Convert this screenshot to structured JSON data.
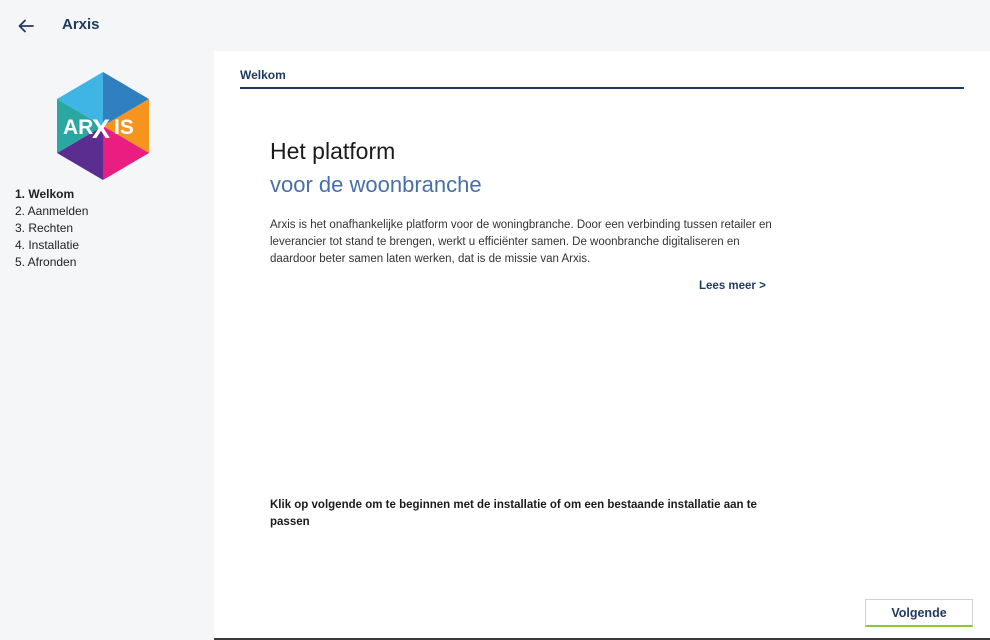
{
  "header": {
    "app_title": "Arxis",
    "back_icon": "arrow-left-icon"
  },
  "logo": {
    "text_left": "AR",
    "text_x": "X",
    "text_right": "IS",
    "colors": [
      "#2f7fc1",
      "#f7941d",
      "#e91e80",
      "#5c2d91",
      "#2aa7a0",
      "#3fb5e6"
    ]
  },
  "steps": [
    {
      "label": "1. Welkom",
      "active": true
    },
    {
      "label": "2. Aanmelden",
      "active": false
    },
    {
      "label": "3. Rechten",
      "active": false
    },
    {
      "label": "4. Installatie",
      "active": false
    },
    {
      "label": "5. Afronden",
      "active": false
    }
  ],
  "main": {
    "tab_label": "Welkom",
    "heading_line1": "Het platform",
    "heading_line2": "voor de woonbranche",
    "intro_text": "Arxis is het onafhankelijke platform voor de woningbranche. Door een verbinding tussen retailer en leverancier tot stand te brengen, werkt u efficiënter samen. De woonbranche digitaliseren en daardoor beter samen laten werken, dat is de missie van Arxis.",
    "read_more": "Lees meer >",
    "instruction": "Klik op volgende om te beginnen met de installatie of om een bestaande installatie aan te passen",
    "next_button": "Volgende"
  },
  "colors": {
    "primary": "#1e3a5f",
    "accent_blue": "#4a6fa5",
    "button_accent": "#8cc63f"
  }
}
